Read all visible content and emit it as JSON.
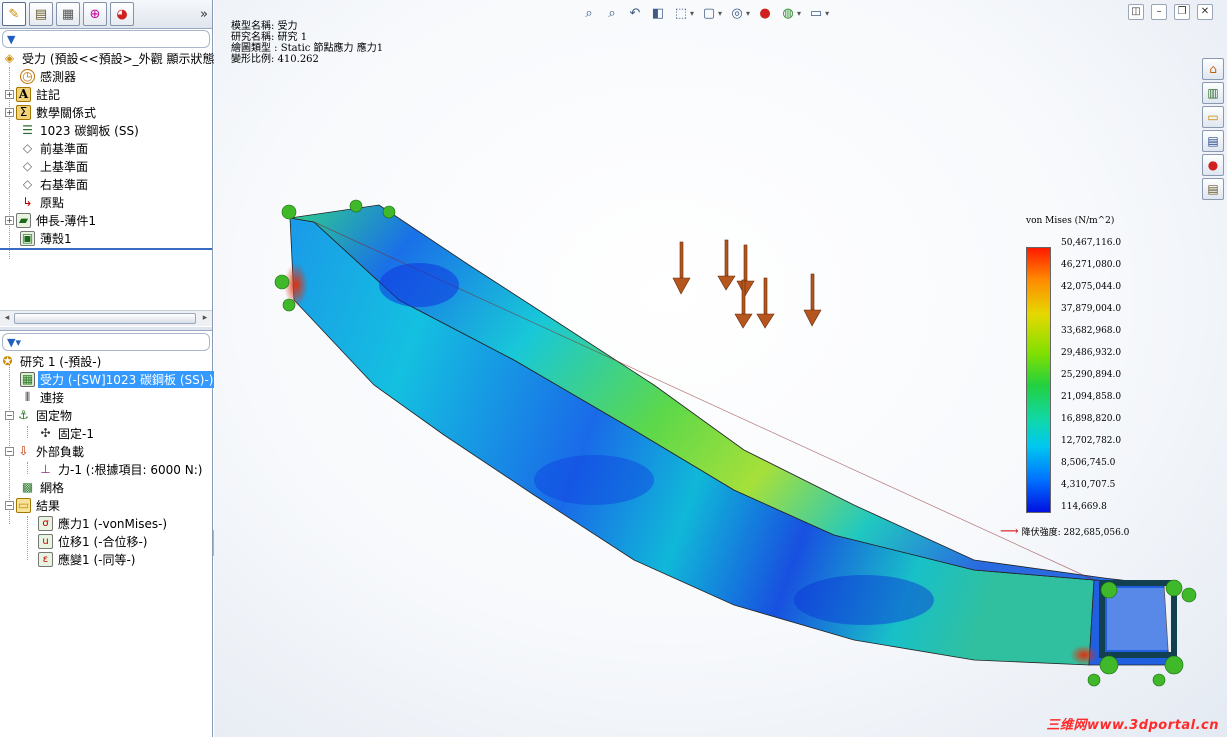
{
  "left_panel": {
    "tabs": [
      "feature-manager-tab",
      "property-manager-tab",
      "configuration-manager-tab",
      "dimxpert-tab",
      "display-manager-tab"
    ],
    "tab_more": "»",
    "feature_tree": {
      "root": "受力  (預設<<預設>_外觀 顯示狀態",
      "items": [
        {
          "label": "感測器"
        },
        {
          "label": "註記"
        },
        {
          "label": "數學關係式"
        },
        {
          "label": "1023 碳鋼板 (SS)"
        },
        {
          "label": "前基準面"
        },
        {
          "label": "上基準面"
        },
        {
          "label": "右基準面"
        },
        {
          "label": "原點"
        },
        {
          "label": "伸長-薄件1"
        },
        {
          "label": "薄殼1"
        }
      ]
    },
    "study_tree": {
      "root": "研究 1 (-預設-)",
      "items": [
        {
          "label": "受力 (-[SW]1023 碳鋼板 (SS)-)",
          "selected": true
        },
        {
          "label": "連接"
        },
        {
          "label": "固定物"
        },
        {
          "label": "固定-1"
        },
        {
          "label": "外部負載"
        },
        {
          "label": "力-1 (:根據項目: 6000 N:)"
        },
        {
          "label": "網格"
        },
        {
          "label": "結果"
        },
        {
          "label": "應力1 (-vonMises-)"
        },
        {
          "label": "位移1 (-合位移-)"
        },
        {
          "label": "應變1 (-同等-)"
        }
      ]
    }
  },
  "viewport": {
    "info": [
      "模型名稱: 受力",
      "研究名稱: 研究 1",
      "繪圖類型 : Static 節點應力 應力1",
      "變形比例: 410.262"
    ],
    "legend": {
      "title": "von Mises (N/m^2)",
      "values": [
        "50,467,116.0",
        "46,271,080.0",
        "42,075,044.0",
        "37,879,004.0",
        "33,682,968.0",
        "29,486,932.0",
        "25,290,894.0",
        "21,094,858.0",
        "16,898,820.0",
        "12,702,782.0",
        "8,506,745.0",
        "4,310,707.5",
        "114,669.8"
      ],
      "yield": "降伏強度: 282,685,056.0"
    },
    "watermark": "三维网www.3dportal.cn"
  },
  "colors": {
    "selection": "#3399ff",
    "accent": "#3a6bc4",
    "yield_arrow": "#d00000",
    "fixture": "#3fb82a",
    "load_arrow": "#b5561e"
  }
}
